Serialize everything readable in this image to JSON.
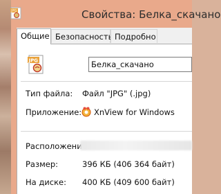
{
  "window": {
    "title": "Свойства: Белка_скачано"
  },
  "tabs": [
    {
      "label": "Общие"
    },
    {
      "label": "Безопасность"
    },
    {
      "label": "Подробно"
    }
  ],
  "general": {
    "file_name": "Белка_скачано",
    "file_type_label": "Тип файла:",
    "file_type_value": "Файл \"JPG\" (.jpg)",
    "app_label": "Приложение:",
    "app_value": "XnView for Windows",
    "location_label": "Расположение:",
    "size_label": "Размер:",
    "size_value": "396 КБ (406 364 байт)",
    "disk_label": "На диске:",
    "disk_value": "400 КБ (409 600 байт)"
  },
  "icons": {
    "title_icon": "jpg-file-icon",
    "file_icon": "jpg-file-icon",
    "app_icon": "xnview-icon"
  }
}
